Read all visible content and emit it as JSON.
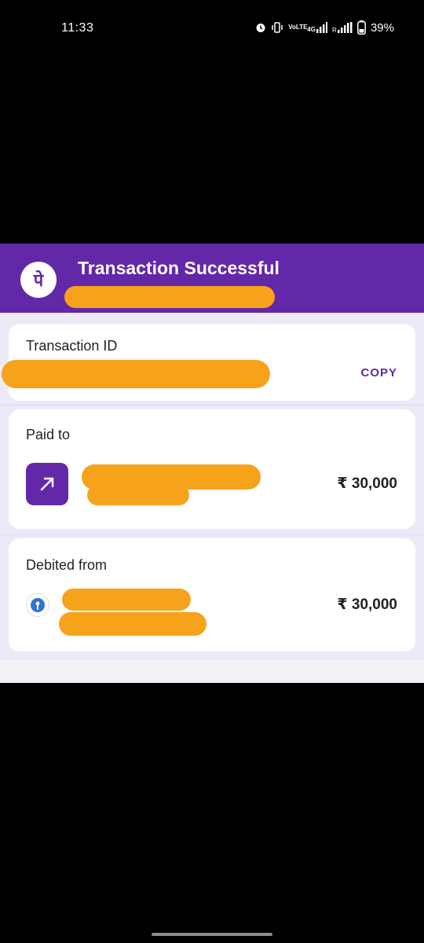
{
  "status_bar": {
    "time": "11:33",
    "battery": "39%",
    "network": "4G",
    "volte": "VoLTE",
    "icons": [
      "alarm-icon",
      "vibrate-icon",
      "volte-icon",
      "signal-4g-icon",
      "signal-icon",
      "battery-icon"
    ]
  },
  "header": {
    "title": "Transaction Successful",
    "logo_glyph": "पे",
    "brand_color": "#6228a8"
  },
  "transaction": {
    "label": "Transaction ID",
    "copy_label": "COPY"
  },
  "paid_to": {
    "label": "Paid to",
    "amount": "₹ 30,000",
    "icon": "arrow-up-right-icon"
  },
  "debited_from": {
    "label": "Debited from",
    "amount": "₹ 30,000",
    "icon": "bank-icon"
  },
  "colors": {
    "accent": "#6228a8",
    "redaction": "#f7a21b",
    "background": "#ede9f7"
  }
}
